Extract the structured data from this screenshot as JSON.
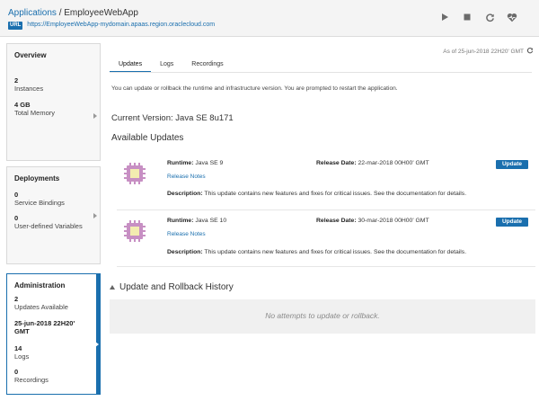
{
  "header": {
    "breadcrumb_root": "Applications",
    "breadcrumb_sep": "/",
    "app_name": "EmployeeWebApp",
    "url_badge": "URL",
    "url": "https://EmployeeWebApp-mydomain.apaas.region.oraclecloud.com",
    "icons": [
      "play-icon",
      "stop-icon",
      "restart-icon",
      "health-icon"
    ]
  },
  "sidebar": {
    "overview": {
      "title": "Overview",
      "instances_value": "2",
      "instances_label": "Instances",
      "memory_value": "4 GB",
      "memory_label": "Total Memory"
    },
    "deployments": {
      "title": "Deployments",
      "bindings_value": "0",
      "bindings_label": "Service Bindings",
      "vars_value": "0",
      "vars_label": "User-defined Variables"
    },
    "administration": {
      "title": "Administration",
      "updates_value": "2",
      "updates_label": "Updates Available",
      "date_line1": "25-jun-2018 22H20'",
      "date_line2": "GMT",
      "logs_value": "14",
      "logs_label": "Logs",
      "recordings_value": "0",
      "recordings_label": "Recordings"
    }
  },
  "main": {
    "as_of": "As of 25-jun-2018 22H20' GMT",
    "tabs": [
      "Updates",
      "Logs",
      "Recordings"
    ],
    "intro": "You can update or rollback the runtime and infrastructure version. You are prompted to restart the application.",
    "current_version": "Current Version: Java SE 8u171",
    "available_title": "Available Updates",
    "updates": [
      {
        "runtime_label": "Runtime:",
        "runtime": "Java SE 9",
        "release_label": "Release Date:",
        "release_date": "22-mar-2018 00H00' GMT",
        "notes": "Release Notes",
        "desc_label": "Description:",
        "desc": "This update contains new features and fixes for critical issues. See the documentation for details.",
        "button": "Update"
      },
      {
        "runtime_label": "Runtime:",
        "runtime": "Java SE 10",
        "release_label": "Release Date:",
        "release_date": "30-mar-2018 00H00' GMT",
        "notes": "Release Notes",
        "desc_label": "Description:",
        "desc": "This update contains new features and fixes for critical issues. See the documentation for details.",
        "button": "Update"
      }
    ],
    "history_title": "Update and Rollback History",
    "history_empty": "No attempts to update or rollback."
  },
  "colors": {
    "accent": "#1a6fae",
    "chip_outer": "#c78fc3",
    "chip_inner": "#f3ecb0"
  }
}
